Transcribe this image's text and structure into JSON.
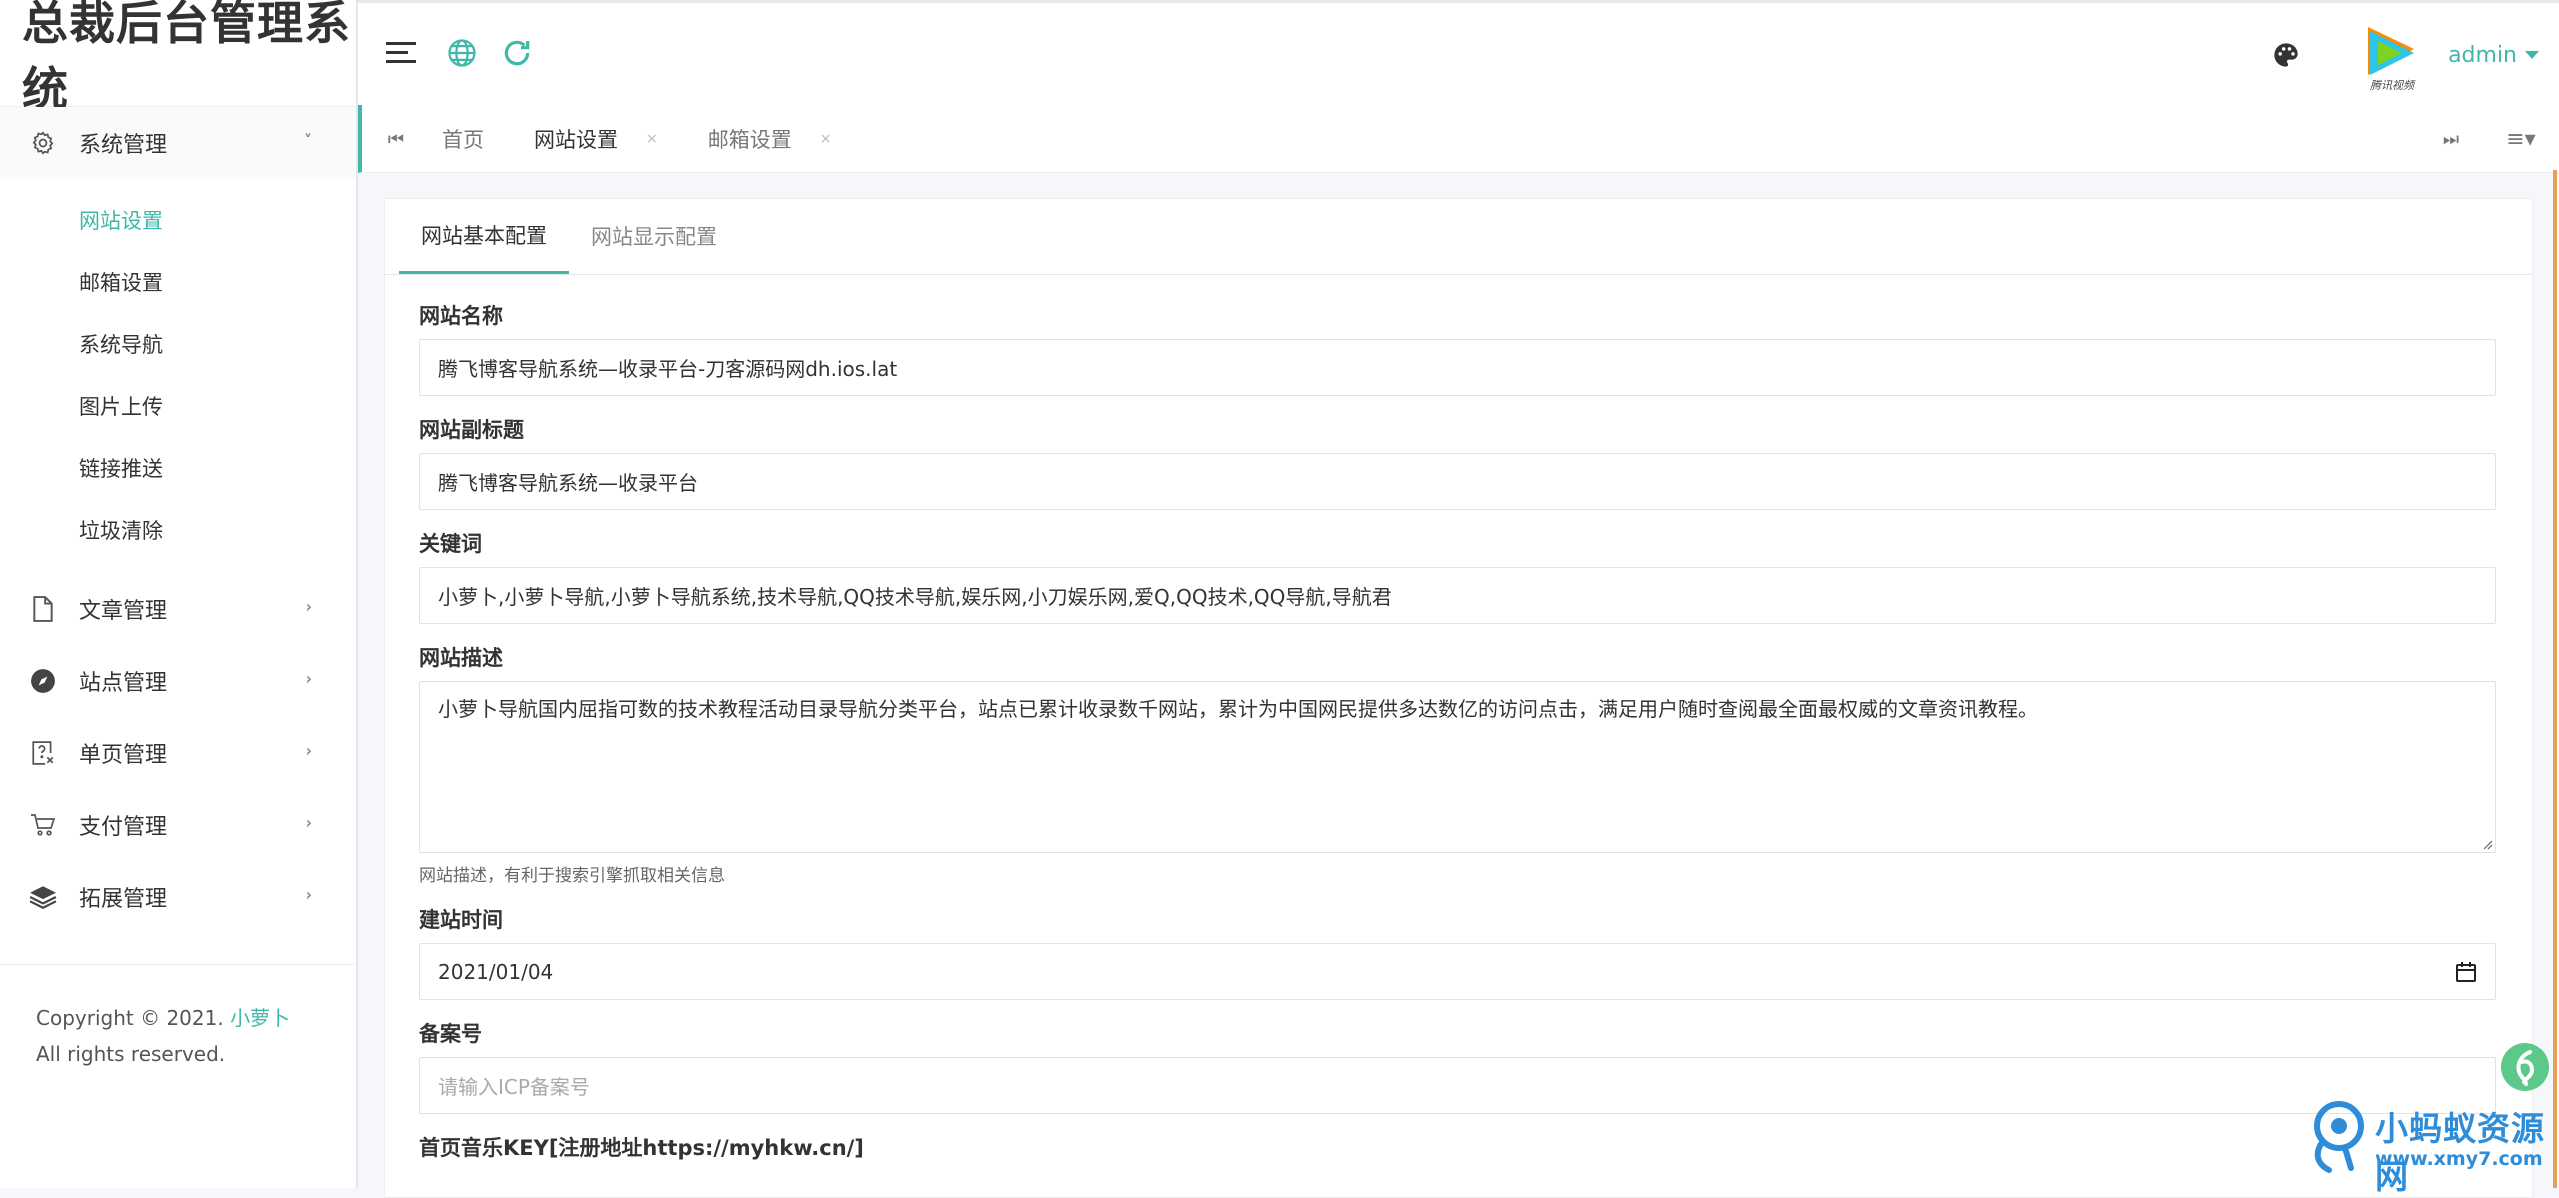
{
  "app": {
    "title": "总裁后台管理系统"
  },
  "sidebar": {
    "groups": [
      {
        "label": "系统管理",
        "icon": "gear-icon",
        "open": true,
        "items": [
          {
            "label": "网站设置",
            "active": true
          },
          {
            "label": "邮箱设置"
          },
          {
            "label": "系统导航"
          },
          {
            "label": "图片上传"
          },
          {
            "label": "链接推送"
          },
          {
            "label": "垃圾清除"
          }
        ]
      },
      {
        "label": "文章管理",
        "icon": "file-icon"
      },
      {
        "label": "站点管理",
        "icon": "compass-icon"
      },
      {
        "label": "单页管理",
        "icon": "help-doc-icon"
      },
      {
        "label": "支付管理",
        "icon": "cart-icon"
      },
      {
        "label": "拓展管理",
        "icon": "layers-icon"
      }
    ],
    "copyright_prefix": "Copyright © 2021.",
    "copyright_brand": "小萝卜",
    "copyright_suffix": "All rights reserved."
  },
  "header": {
    "username": "admin",
    "avatar_caption": "腾讯视频"
  },
  "tabstrip": {
    "tabs": [
      {
        "label": "首页",
        "closable": false
      },
      {
        "label": "网站设置",
        "closable": true,
        "active": true
      },
      {
        "label": "邮箱设置",
        "closable": true
      }
    ],
    "close_glyph": "×"
  },
  "content": {
    "tabs": [
      {
        "label": "网站基本配置",
        "active": true
      },
      {
        "label": "网站显示配置"
      }
    ],
    "fields": {
      "site_name": {
        "label": "网站名称",
        "value": "腾飞博客导航系统—收录平台-刀客源码网dh.ios.lat"
      },
      "subtitle": {
        "label": "网站副标题",
        "value": "腾飞博客导航系统—收录平台"
      },
      "keywords": {
        "label": "关键词",
        "value": "小萝卜,小萝卜导航,小萝卜导航系统,技术导航,QQ技术导航,娱乐网,小刀娱乐网,爱Q,QQ技术,QQ导航,导航君"
      },
      "description": {
        "label": "网站描述",
        "value": "小萝卜导航国内屈指可数的技术教程活动目录导航分类平台，站点已累计收录数千网站，累计为中国网民提供多达数亿的访问点击，满足用户随时查阅最全面最权威的文章资讯教程。",
        "help": "网站描述，有利于搜索引擎抓取相关信息"
      },
      "build_date": {
        "label": "建站时间",
        "value": "2021/01/04"
      },
      "icp": {
        "label": "备案号",
        "placeholder": "请输入ICP备案号"
      },
      "music_key": {
        "label": "首页音乐KEY[注册地址https://myhkw.cn/]"
      }
    }
  },
  "watermark": {
    "name": "小蚂蚁资源网",
    "url": "www.xmy7.com"
  },
  "colors": {
    "accent": "#3fb8a9",
    "watermark": "#2f8cd8"
  }
}
